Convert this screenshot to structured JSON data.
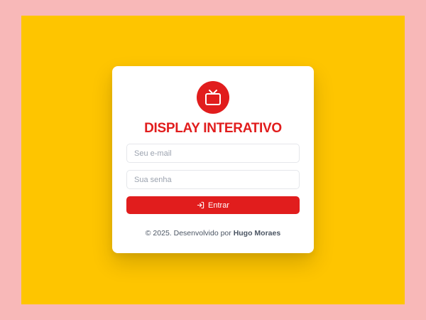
{
  "app": {
    "title": "DISPLAY INTERATIVO",
    "logo_icon": "tv-icon"
  },
  "form": {
    "email_placeholder": "Seu e-mail",
    "password_placeholder": "Sua senha",
    "submit_label": "Entrar",
    "submit_icon": "login-icon"
  },
  "footer": {
    "prefix": "© 2025. Desenvolvido por",
    "author": "Hugo Moraes"
  },
  "colors": {
    "page_background": "#f8b8b8",
    "stage_background": "#fec500",
    "card_background": "#ffffff",
    "accent": "#e11d1d"
  }
}
